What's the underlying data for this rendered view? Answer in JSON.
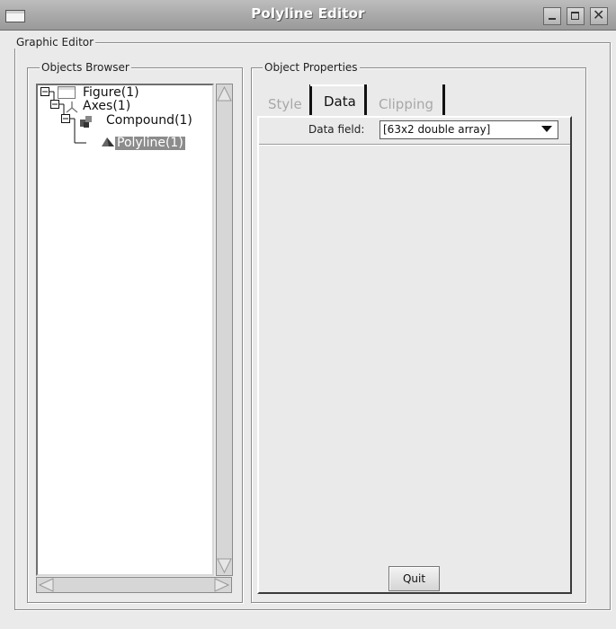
{
  "window": {
    "title": "Polyline Editor"
  },
  "groups": {
    "main": "Graphic Editor",
    "browser": "Objects Browser",
    "properties": "Object Properties"
  },
  "tree": [
    {
      "label": "Figure(1)",
      "icon": "window-icon"
    },
    {
      "label": "Axes(1)",
      "icon": "axes-icon"
    },
    {
      "label": "Compound(1)",
      "icon": "compound-icon"
    },
    {
      "label": "Polyline(1)",
      "icon": "polyline-icon",
      "selected": true
    }
  ],
  "tabs": [
    {
      "label": "Style",
      "active": false
    },
    {
      "label": "Data",
      "active": true
    },
    {
      "label": "Clipping",
      "active": false
    }
  ],
  "data_field": {
    "label": "Data field:",
    "value": "[63x2 double array]"
  },
  "buttons": {
    "quit": "Quit"
  }
}
